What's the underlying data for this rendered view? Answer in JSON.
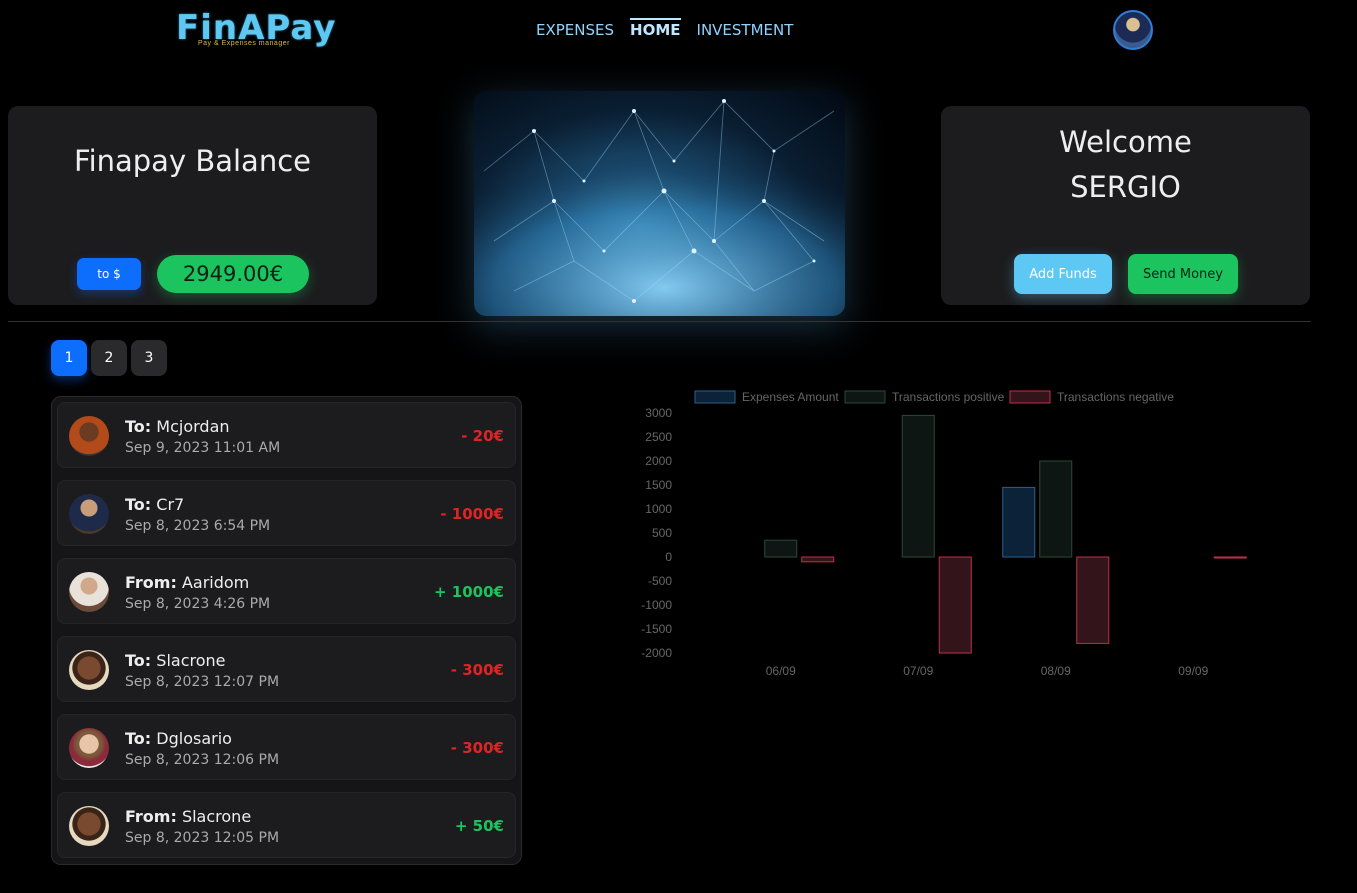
{
  "header": {
    "logo_text": "FinAPay",
    "logo_tagline": "Pay & Expenses manager",
    "nav": [
      {
        "label": "EXPENSES",
        "active": false
      },
      {
        "label": "HOME",
        "active": true
      },
      {
        "label": "INVESTMENT",
        "active": false
      }
    ]
  },
  "balance": {
    "title": "Finapay Balance",
    "convert_label": "to $",
    "amount": "2949.00€"
  },
  "welcome": {
    "line1": "Welcome",
    "line2": "SERGIO",
    "add_funds_label": "Add Funds",
    "send_money_label": "Send Money"
  },
  "pagination": {
    "pages": [
      "1",
      "2",
      "3"
    ],
    "active": "1"
  },
  "transactions": [
    {
      "direction": "To:",
      "name": "Mcjordan",
      "date": "Sep 9, 2023 11:01 AM",
      "amount": "- 20€",
      "type": "neg",
      "avatar_color": "#8b3a1e"
    },
    {
      "direction": "To:",
      "name": "Cr7",
      "date": "Sep 8, 2023 6:54 PM",
      "amount": "- 1000€",
      "type": "neg",
      "avatar_color": "#3a4a7a"
    },
    {
      "direction": "From:",
      "name": "Aaridom",
      "date": "Sep 8, 2023 4:26 PM",
      "amount": "+ 1000€",
      "type": "pos",
      "avatar_color": "#8a6a5a"
    },
    {
      "direction": "To:",
      "name": "Slacrone",
      "date": "Sep 8, 2023 12:07 PM",
      "amount": "- 300€",
      "type": "neg",
      "avatar_color": "#d8c7a8"
    },
    {
      "direction": "To:",
      "name": "Dglosario",
      "date": "Sep 8, 2023 12:06 PM",
      "amount": "- 300€",
      "type": "neg",
      "avatar_color": "#e0e0e0"
    },
    {
      "direction": "From:",
      "name": "Slacrone",
      "date": "Sep 8, 2023 12:05 PM",
      "amount": "+ 50€",
      "type": "pos",
      "avatar_color": "#d8c7a8"
    }
  ],
  "chart_data": {
    "type": "bar",
    "categories": [
      "06/09",
      "07/09",
      "08/09",
      "09/09"
    ],
    "series": [
      {
        "name": "Expenses Amount",
        "values": [
          0,
          0,
          1450,
          0
        ],
        "fill": "#0b2238",
        "stroke": "#2b5f8a"
      },
      {
        "name": "Transactions positive",
        "values": [
          350,
          2950,
          2000,
          0
        ],
        "fill": "#0d1612",
        "stroke": "#2a4a36"
      },
      {
        "name": "Transactions negative",
        "values": [
          -100,
          -2000,
          -1800,
          -20
        ],
        "fill": "#33141a",
        "stroke": "#c0304a"
      }
    ],
    "yticks": [
      3000,
      2500,
      2000,
      1500,
      1000,
      500,
      0,
      -500,
      -1000,
      -1500,
      -2000
    ],
    "ylim": [
      -2000,
      3000
    ],
    "legend_position": "top"
  }
}
